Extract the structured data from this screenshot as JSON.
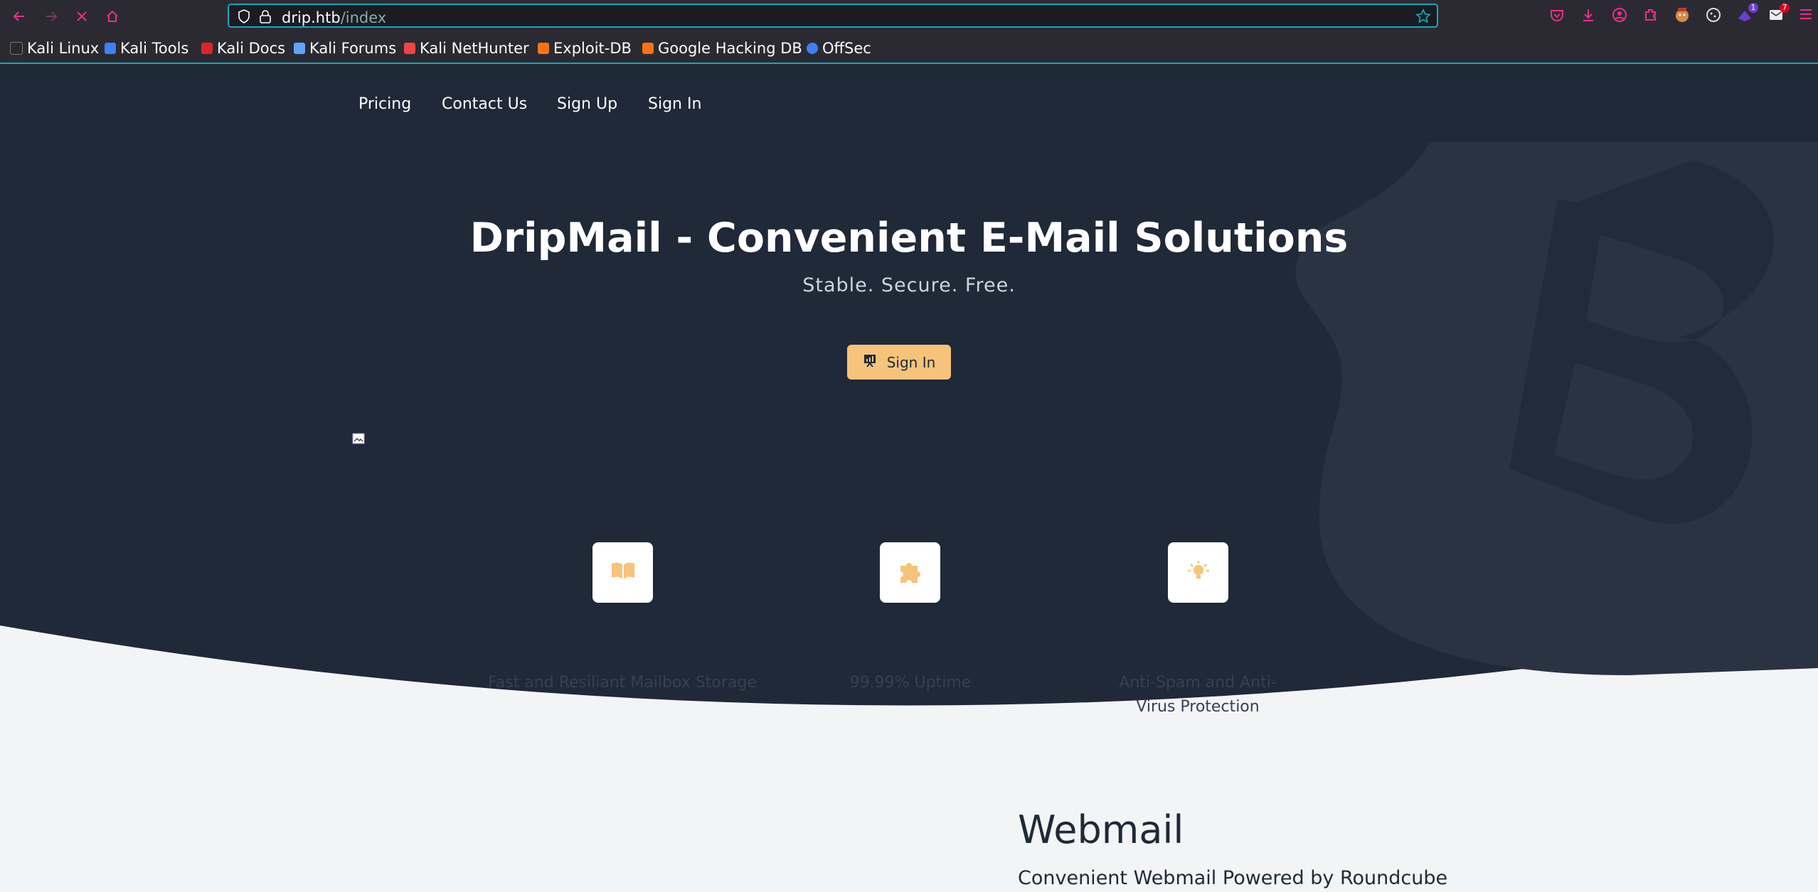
{
  "browser": {
    "url_host": "drip.htb",
    "url_path": "/index",
    "bookmarks": [
      "Kali Linux",
      "Kali Tools",
      "Kali Docs",
      "Kali Forums",
      "Kali NetHunter",
      "Exploit-DB",
      "Google Hacking DB",
      "OffSec"
    ],
    "extension_badges": [
      "1",
      "7"
    ]
  },
  "nav": {
    "pricing": "Pricing",
    "contact": "Contact Us",
    "signup": "Sign Up",
    "signin": "Sign In"
  },
  "hero": {
    "title": "DripMail - Convenient E-Mail Solutions",
    "subtitle": "Stable. Secure. Free.",
    "button": "Sign In"
  },
  "features": [
    {
      "icon": "book-icon",
      "label": "Fast and Resiliant Mailbox Storage"
    },
    {
      "icon": "puzzle-icon",
      "label": "99.99% Uptime"
    },
    {
      "icon": "lightbulb-icon",
      "label": "Anti-Spam and Anti-Virus Protection"
    }
  ],
  "webmail": {
    "title": "Webmail",
    "subtitle": "Convenient Webmail Powered by Roundcube"
  },
  "colors": {
    "hero_bg": "#1f2937",
    "accent": "#f6c37a",
    "page_bg": "#f3f4f6",
    "browser_accent": "#17a9b8",
    "toolbar_icons": "#e8308c"
  }
}
